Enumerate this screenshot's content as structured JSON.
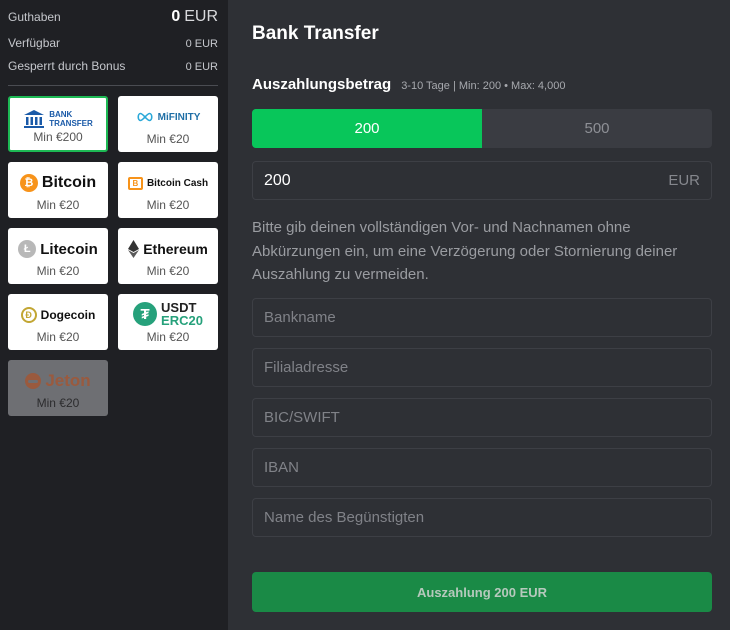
{
  "balance": {
    "guthaben_label": "Guthaben",
    "guthaben_num": "0",
    "guthaben_cur": "EUR",
    "verfuegbar_label": "Verfügbar",
    "verfuegbar_value": "0 EUR",
    "gesperrt_label": "Gesperrt durch Bonus",
    "gesperrt_value": "0 EUR"
  },
  "methods": {
    "bank": {
      "logo_line1": "BANK",
      "logo_line2": "TRANSFER",
      "min": "Min €200"
    },
    "mifinity": {
      "logo": "MiFINITY",
      "min": "Min €20"
    },
    "bitcoin": {
      "logo": "Bitcoin",
      "min": "Min €20"
    },
    "bitcoincash": {
      "logo": "Bitcoin Cash",
      "min": "Min €20"
    },
    "litecoin": {
      "logo": "Litecoin",
      "min": "Min €20"
    },
    "ethereum": {
      "logo": "Ethereum",
      "min": "Min €20"
    },
    "dogecoin": {
      "logo": "Dogecoin",
      "min": "Min €20"
    },
    "usdt": {
      "logo_line1": "USDT",
      "logo_line2": "ERC20",
      "min": "Min €20"
    },
    "jeton": {
      "logo": "Jeton",
      "min": "Min €20"
    }
  },
  "form": {
    "title": "Bank Transfer",
    "amount_heading": "Auszahlungsbetrag",
    "amount_sub": "3-10 Tage | Min: 200 • Max: 4,000",
    "preset_1": "200",
    "preset_2": "500",
    "amount_value": "200",
    "amount_currency": "EUR",
    "note": "Bitte gib deinen vollständigen Vor- und Nachnamen ohne Abkürzungen ein, um eine Verzögerung oder Stornierung deiner Auszahlung zu vermeiden.",
    "bankname_placeholder": "Bankname",
    "branch_placeholder": "Filialadresse",
    "bic_placeholder": "BIC/SWIFT",
    "iban_placeholder": "IBAN",
    "beneficiary_placeholder": "Name des Begünstigten",
    "submit_label": "Auszahlung 200 EUR"
  },
  "colors": {
    "accent": "#08c65a",
    "submit": "#1a8a46",
    "panel_left": "#1f2024",
    "panel_right": "#2e3035",
    "bitcoin": "#f7931a",
    "tether": "#26a17b",
    "jeton": "#e4572e"
  }
}
